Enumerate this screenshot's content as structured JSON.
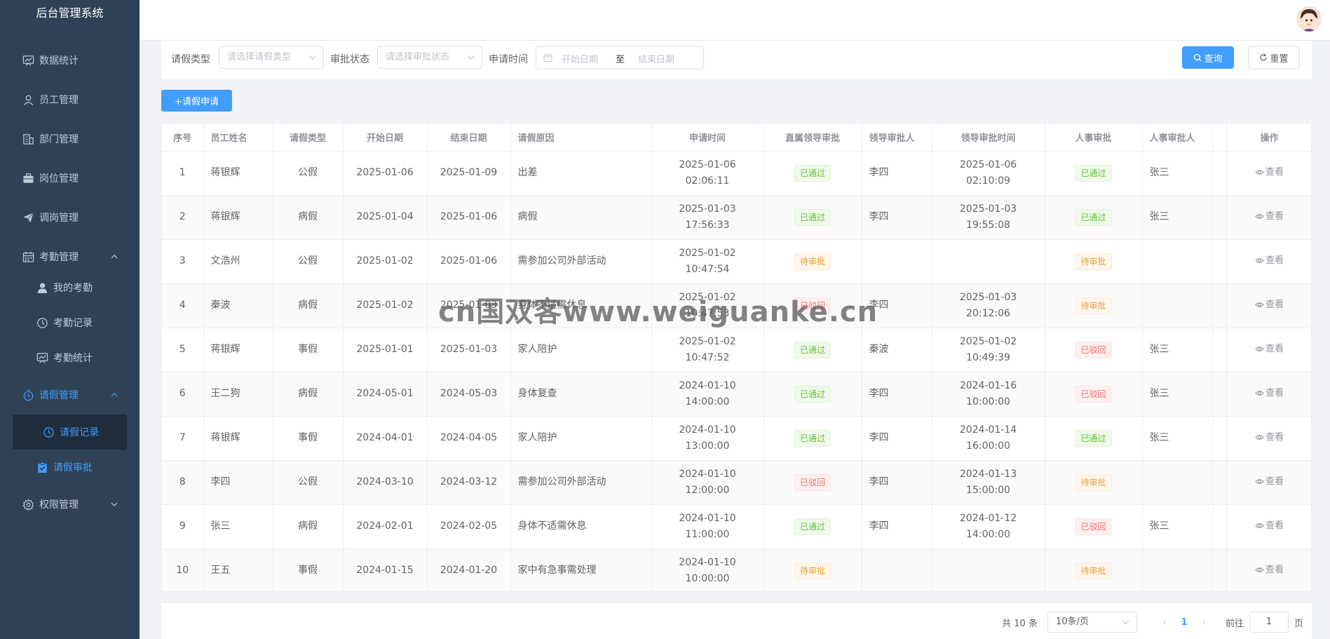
{
  "app_title": "后台管理系统",
  "sidebar": {
    "items": [
      {
        "label": "数据统计",
        "icon": "chart-icon"
      },
      {
        "label": "员工管理",
        "icon": "user-icon"
      },
      {
        "label": "部门管理",
        "icon": "building-icon"
      },
      {
        "label": "岗位管理",
        "icon": "briefcase-icon"
      },
      {
        "label": "调岗管理",
        "icon": "send-icon"
      },
      {
        "label": "考勤管理",
        "icon": "calendar-icon"
      },
      {
        "label": "我的考勤",
        "icon": "user-solid-icon"
      },
      {
        "label": "考勤记录",
        "icon": "clock-icon"
      },
      {
        "label": "考勤统计",
        "icon": "chart-icon"
      },
      {
        "label": "请假管理",
        "icon": "timer-icon"
      },
      {
        "label": "请假记录",
        "icon": "clock-icon"
      },
      {
        "label": "请假审批",
        "icon": "clipboard-icon"
      },
      {
        "label": "权限管理",
        "icon": "gear-icon"
      }
    ]
  },
  "filters": {
    "leave_type_label": "请假类型",
    "leave_type_placeholder": "请选择请假类型",
    "approval_status_label": "审批状态",
    "approval_status_placeholder": "请选择审批状态",
    "apply_time_label": "申请时间",
    "start_placeholder": "开始日期",
    "range_separator": "至",
    "end_placeholder": "结束日期",
    "query_label": "查询",
    "reset_label": "重置"
  },
  "add_button_label": "+请假申请",
  "table": {
    "columns": [
      "序号",
      "员工姓名",
      "请假类型",
      "开始日期",
      "结束日期",
      "请假原因",
      "申请时间",
      "直属领导审批",
      "领导审批人",
      "领导审批时间",
      "人事审批",
      "人事审批人",
      "",
      "操作"
    ],
    "view_label": "查看",
    "rows": [
      {
        "no": "1",
        "name": "蒋银辉",
        "type": "公假",
        "start": "2025-01-06",
        "end": "2025-01-09",
        "reason": "出差",
        "apply_date": "2025-01-06",
        "apply_time": "02:06:11",
        "leader_status": "已通过",
        "leader_status_kind": "success",
        "leader": "李四",
        "leader_date": "2025-01-06",
        "leader_time": "02:10:09",
        "hr_status": "已通过",
        "hr_status_kind": "success",
        "hr": "张三"
      },
      {
        "no": "2",
        "name": "蒋银辉",
        "type": "病假",
        "start": "2025-01-04",
        "end": "2025-01-06",
        "reason": "病假",
        "apply_date": "2025-01-03",
        "apply_time": "17:56:33",
        "leader_status": "已通过",
        "leader_status_kind": "success",
        "leader": "李四",
        "leader_date": "2025-01-03",
        "leader_time": "19:55:08",
        "hr_status": "已通过",
        "hr_status_kind": "success",
        "hr": "张三"
      },
      {
        "no": "3",
        "name": "文浩州",
        "type": "公假",
        "start": "2025-01-02",
        "end": "2025-01-06",
        "reason": "需参加公司外部活动",
        "apply_date": "2025-01-02",
        "apply_time": "10:47:54",
        "leader_status": "待审批",
        "leader_status_kind": "warning",
        "leader": "",
        "leader_date": "",
        "leader_time": "",
        "hr_status": "待审批",
        "hr_status_kind": "warning",
        "hr": ""
      },
      {
        "no": "4",
        "name": "秦波",
        "type": "病假",
        "start": "2025-01-02",
        "end": "2025-01-03",
        "reason": "身体不适需休息",
        "apply_date": "2025-01-02",
        "apply_time": "10:47:53",
        "leader_status": "已驳回",
        "leader_status_kind": "danger",
        "leader": "李四",
        "leader_date": "2025-01-03",
        "leader_time": "20:12:06",
        "hr_status": "待审批",
        "hr_status_kind": "warning",
        "hr": ""
      },
      {
        "no": "5",
        "name": "蒋银辉",
        "type": "事假",
        "start": "2025-01-01",
        "end": "2025-01-03",
        "reason": "家人陪护",
        "apply_date": "2025-01-02",
        "apply_time": "10:47:52",
        "leader_status": "已通过",
        "leader_status_kind": "success",
        "leader": "秦波",
        "leader_date": "2025-01-02",
        "leader_time": "10:49:39",
        "hr_status": "已驳回",
        "hr_status_kind": "danger",
        "hr": "张三"
      },
      {
        "no": "6",
        "name": "王二狗",
        "type": "病假",
        "start": "2024-05-01",
        "end": "2024-05-03",
        "reason": "身体复查",
        "apply_date": "2024-01-10",
        "apply_time": "14:00:00",
        "leader_status": "已通过",
        "leader_status_kind": "success",
        "leader": "李四",
        "leader_date": "2024-01-16",
        "leader_time": "10:00:00",
        "hr_status": "已驳回",
        "hr_status_kind": "danger",
        "hr": "张三"
      },
      {
        "no": "7",
        "name": "蒋银辉",
        "type": "事假",
        "start": "2024-04-01",
        "end": "2024-04-05",
        "reason": "家人陪护",
        "apply_date": "2024-01-10",
        "apply_time": "13:00:00",
        "leader_status": "已通过",
        "leader_status_kind": "success",
        "leader": "李四",
        "leader_date": "2024-01-14",
        "leader_time": "16:00:00",
        "hr_status": "已通过",
        "hr_status_kind": "success",
        "hr": "张三"
      },
      {
        "no": "8",
        "name": "李四",
        "type": "公假",
        "start": "2024-03-10",
        "end": "2024-03-12",
        "reason": "需参加公司外部活动",
        "apply_date": "2024-01-10",
        "apply_time": "12:00:00",
        "leader_status": "已驳回",
        "leader_status_kind": "danger",
        "leader": "李四",
        "leader_date": "2024-01-13",
        "leader_time": "15:00:00",
        "hr_status": "待审批",
        "hr_status_kind": "warning",
        "hr": ""
      },
      {
        "no": "9",
        "name": "张三",
        "type": "病假",
        "start": "2024-02-01",
        "end": "2024-02-05",
        "reason": "身体不适需休息",
        "apply_date": "2024-01-10",
        "apply_time": "11:00:00",
        "leader_status": "已通过",
        "leader_status_kind": "success",
        "leader": "李四",
        "leader_date": "2024-01-12",
        "leader_time": "14:00:00",
        "hr_status": "已驳回",
        "hr_status_kind": "danger",
        "hr": "张三"
      },
      {
        "no": "10",
        "name": "王五",
        "type": "事假",
        "start": "2024-01-15",
        "end": "2024-01-20",
        "reason": "家中有急事需处理",
        "apply_date": "2024-01-10",
        "apply_time": "10:00:00",
        "leader_status": "待审批",
        "leader_status_kind": "warning",
        "leader": "",
        "leader_date": "",
        "leader_time": "",
        "hr_status": "待审批",
        "hr_status_kind": "warning",
        "hr": ""
      }
    ]
  },
  "pagination": {
    "total_text": "共 10 条",
    "page_size": "10条/页",
    "current_page": "1",
    "goto_label": "前往",
    "goto_value": "1",
    "page_suffix": "页"
  },
  "watermark": "cn国双客www.weiguanke.cn",
  "colors": {
    "primary": "#409eff",
    "sidebar_bg": "#304156",
    "success": "#67c23a",
    "warning": "#e6a23c",
    "danger": "#f56c6c"
  }
}
